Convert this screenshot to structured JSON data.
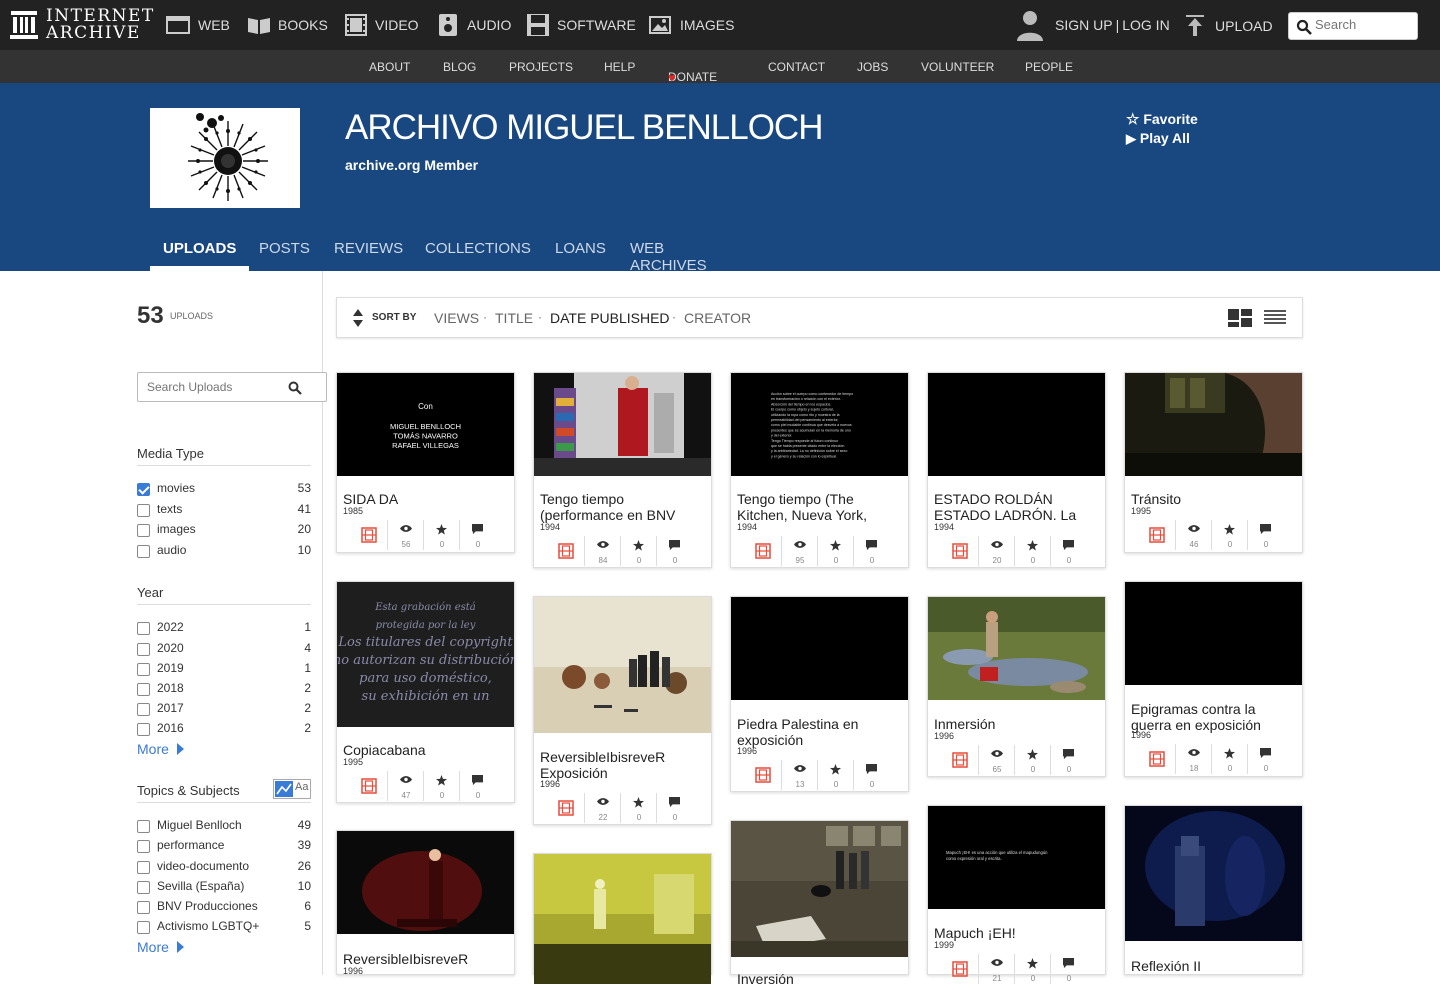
{
  "topnav": {
    "logo_line1": "INTERNET",
    "logo_line2": "ARCHIVE",
    "items": [
      "WEB",
      "BOOKS",
      "VIDEO",
      "AUDIO",
      "SOFTWARE",
      "IMAGES"
    ],
    "signup": "SIGN UP",
    "sep": "|",
    "login": "LOG IN",
    "upload": "UPLOAD",
    "search_placeholder": "Search"
  },
  "subnav": {
    "items": [
      "ABOUT",
      "BLOG",
      "PROJECTS",
      "HELP",
      "DONATE",
      "CONTACT",
      "JOBS",
      "VOLUNTEER",
      "PEOPLE"
    ],
    "donate_heart": "♥"
  },
  "banner": {
    "title": "ARCHIVO MIGUEL BENLLOCH",
    "subtitle": "archive.org Member",
    "favorite": "Favorite",
    "play_all": "Play All"
  },
  "tabs": [
    "UPLOADS",
    "POSTS",
    "REVIEWS",
    "COLLECTIONS",
    "LOANS",
    "WEB ARCHIVES"
  ],
  "uploads": {
    "count": "53",
    "label": "UPLOADS",
    "search_placeholder": "Search Uploads"
  },
  "filters": {
    "media_type": {
      "title": "Media Type",
      "items": [
        {
          "label": "movies",
          "count": "53",
          "checked": true
        },
        {
          "label": "texts",
          "count": "41",
          "checked": false
        },
        {
          "label": "images",
          "count": "20",
          "checked": false
        },
        {
          "label": "audio",
          "count": "10",
          "checked": false
        }
      ]
    },
    "year": {
      "title": "Year",
      "items": [
        {
          "label": "2022",
          "count": "1"
        },
        {
          "label": "2020",
          "count": "4"
        },
        {
          "label": "2019",
          "count": "1"
        },
        {
          "label": "2018",
          "count": "2"
        },
        {
          "label": "2017",
          "count": "2"
        },
        {
          "label": "2016",
          "count": "2"
        }
      ],
      "more": "More"
    },
    "topics": {
      "title": "Topics & Subjects",
      "toggle_label": "Aa",
      "items": [
        {
          "label": "Miguel Benlloch",
          "count": "49"
        },
        {
          "label": "performance",
          "count": "39"
        },
        {
          "label": "video-documento",
          "count": "26"
        },
        {
          "label": "Sevilla (España)",
          "count": "10"
        },
        {
          "label": "BNV Producciones",
          "count": "6"
        },
        {
          "label": "Activismo LGBTQ+",
          "count": "5"
        }
      ],
      "more": "More"
    }
  },
  "sort": {
    "label": "SORT BY",
    "options": [
      "VIEWS",
      "TITLE",
      "DATE PUBLISHED",
      "CREATOR"
    ],
    "selected": "DATE PUBLISHED",
    "dot": "·"
  },
  "thumb_texts": {
    "sida_con": "Con",
    "sida_names": [
      "MIGUEL BENLLOCH",
      "TOMÁS NAVARRO",
      "RAFAEL VILLEGAS"
    ],
    "copia_lines": [
      "Esta grabación está",
      "protegida por la ley",
      "Los titulares del copyright",
      "no autorizan su distribución",
      "para uso doméstico,",
      "su exhibición en un"
    ],
    "tt_lines": [
      "Acción sobre el cuerpo como contenedor de tiempo",
      "en transformación o relación con el exterior.",
      "Absorción del tiempo en los espacios.",
      "El cuerpo como objeto y sujeto cultural,",
      "utilizando la ropa como rito y muestra de la",
      "permeabilidad del pensamiento al exterior,",
      "como piel mudable continua que desvela a nuevos",
      "presentes que se acumulan en la memoria de uno",
      "y del exterior.",
      "Tengo Tiempo responde al futuro continuo",
      "que se habla presente citado entre la elección",
      "y la arbitrariedad. La no definición sobre el sexo",
      "y el género y su relación con lo espiritual."
    ],
    "mapuch_lines": [
      "Mapuch ¡EH! es una acción que utiliza el mapudungún",
      "como expresión oral y escrita."
    ]
  },
  "items": [
    {
      "title": "SIDA DA",
      "date": "1985",
      "views": "56",
      "favs": "0",
      "reviews": "0"
    },
    {
      "title": "Tengo tiempo (performance en BNV",
      "date": "1994",
      "views": "84",
      "favs": "0",
      "reviews": "0"
    },
    {
      "title": "Tengo tiempo (The Kitchen, Nueva York,",
      "date": "1994",
      "views": "95",
      "favs": "0",
      "reviews": "0"
    },
    {
      "title": "ESTADO ROLDÁN ESTADO LADRÓN. La",
      "date": "1994",
      "views": "20",
      "favs": "0",
      "reviews": "0"
    },
    {
      "title": "Tránsito",
      "date": "1995",
      "views": "46",
      "favs": "0",
      "reviews": "0"
    },
    {
      "title": "Copiacabana",
      "date": "1995",
      "views": "47",
      "favs": "0",
      "reviews": "0"
    },
    {
      "title": "ReversibleIbisreveR Exposición",
      "date": "1996",
      "views": "22",
      "favs": "0",
      "reviews": "0"
    },
    {
      "title": "Piedra Palestina en exposición",
      "date": "1996",
      "views": "13",
      "favs": "0",
      "reviews": "0"
    },
    {
      "title": "Inmersión",
      "date": "1996",
      "views": "65",
      "favs": "0",
      "reviews": "0"
    },
    {
      "title": "Epigramas contra la guerra en exposición",
      "date": "1996",
      "views": "18",
      "favs": "0",
      "reviews": "0"
    },
    {
      "title": "ReversibleIbisreveR",
      "date": "1996",
      "views": "",
      "favs": "",
      "reviews": ""
    },
    {
      "title": "",
      "date": "",
      "views": "",
      "favs": "",
      "reviews": ""
    },
    {
      "title": "Inversión",
      "date": "",
      "views": "",
      "favs": "",
      "reviews": ""
    },
    {
      "title": "Mapuch ¡EH!",
      "date": "1999",
      "views": "21",
      "favs": "0",
      "reviews": "0"
    },
    {
      "title": "Reflexión II",
      "date": "",
      "views": "",
      "favs": "",
      "reviews": ""
    }
  ]
}
